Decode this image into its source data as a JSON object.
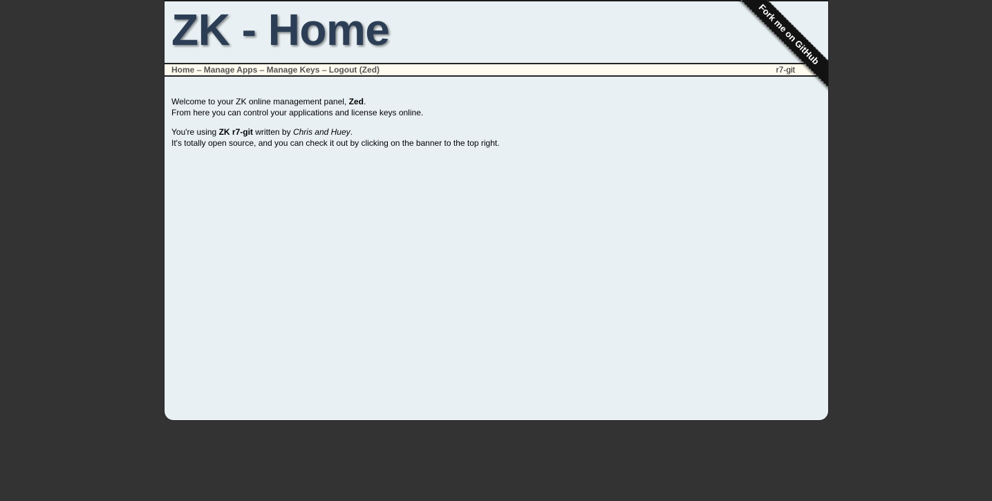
{
  "header": {
    "title": "ZK - Home"
  },
  "ribbon": {
    "label": "Fork me on GitHub"
  },
  "nav": {
    "items": [
      {
        "label": "Home"
      },
      {
        "label": "Manage Apps"
      },
      {
        "label": "Manage Keys"
      },
      {
        "label": "Logout (Zed)"
      }
    ],
    "separator": "–",
    "version": "r7-git"
  },
  "content": {
    "welcome_prefix": "Welcome to your ZK online management panel, ",
    "username": "Zed",
    "welcome_suffix": ".",
    "control_line": "From here you can control your applications and license keys online.",
    "using_prefix": "You're using ",
    "product": "ZK r7-git",
    "written_by": " written by ",
    "authors": "Chris and Huey",
    "using_suffix": ".",
    "open_source_line": "It's totally open source, and you can check it out by clicking on the banner to the top right."
  }
}
